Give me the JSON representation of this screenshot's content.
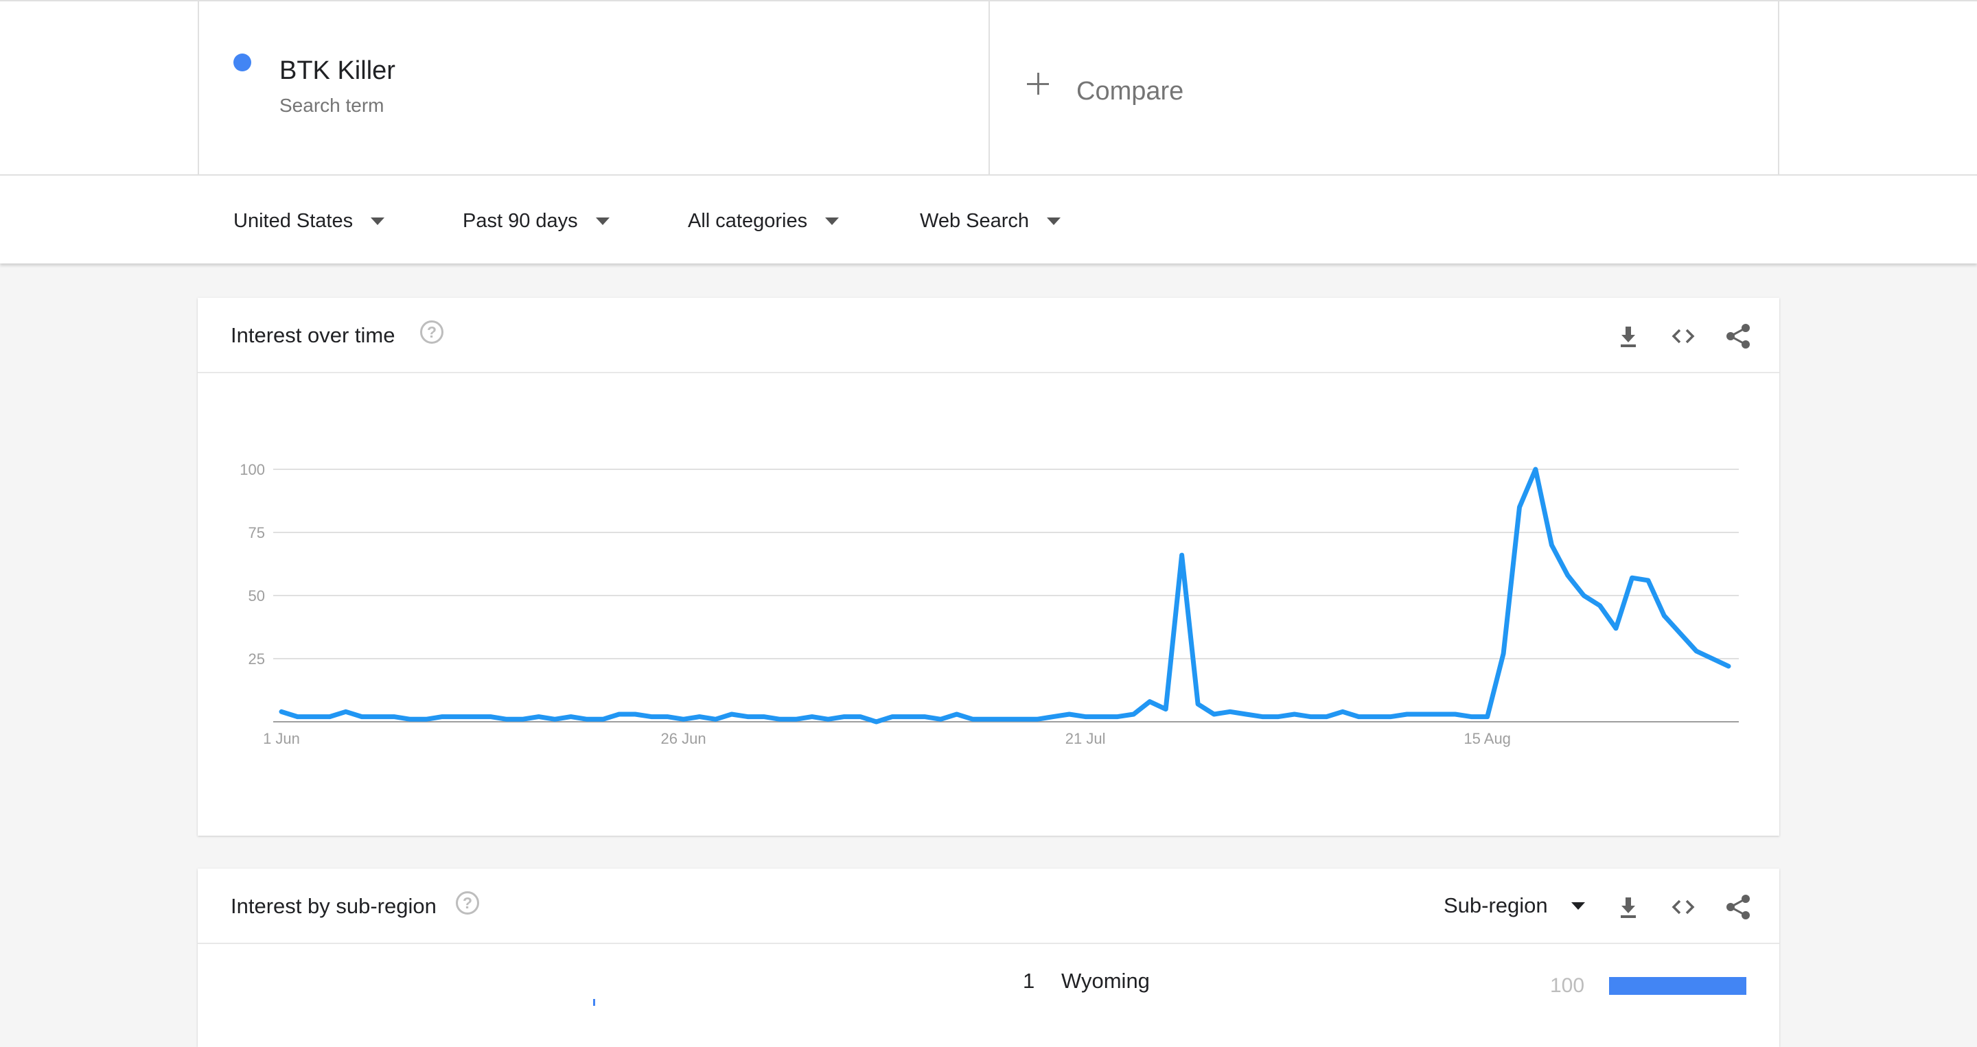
{
  "search_term": {
    "name": "BTK Killer",
    "subtitle": "Search term",
    "color": "#4285f4"
  },
  "compare": {
    "label": "Compare"
  },
  "filters": {
    "region": "United States",
    "time": "Past 90 days",
    "category": "All categories",
    "property": "Web Search"
  },
  "interest_over_time": {
    "title": "Interest over time",
    "help_icon_glyph": "?",
    "actions": [
      "download-icon",
      "embed-code-icon",
      "share-icon"
    ]
  },
  "interest_by_subregion": {
    "title": "Interest by sub-region",
    "help_icon_glyph": "?",
    "resolution_select": "Sub-region",
    "actions": [
      "download-icon",
      "embed-code-icon",
      "share-icon"
    ],
    "rows": [
      {
        "rank": "1",
        "name": "Wyoming",
        "value": "100",
        "bar_fraction": 1.0
      }
    ]
  },
  "chart_data": {
    "type": "line",
    "title": "Interest over time",
    "x_tick_labels": [
      "1 Jun",
      "26 Jun",
      "21 Jul",
      "15 Aug"
    ],
    "y_tick_labels": [
      "100",
      "75",
      "50",
      "25"
    ],
    "ylim": [
      0,
      100
    ],
    "grid": true,
    "line_color": "#2196f3",
    "series": [
      {
        "name": "BTK Killer",
        "values": [
          4,
          2,
          2,
          2,
          4,
          2,
          2,
          2,
          1,
          1,
          2,
          2,
          2,
          2,
          1,
          1,
          2,
          1,
          2,
          1,
          1,
          3,
          3,
          2,
          2,
          1,
          2,
          1,
          3,
          2,
          2,
          1,
          1,
          2,
          1,
          2,
          2,
          0,
          2,
          2,
          2,
          1,
          3,
          1,
          1,
          1,
          1,
          1,
          2,
          3,
          2,
          2,
          2,
          3,
          8,
          5,
          66,
          7,
          3,
          4,
          3,
          2,
          2,
          3,
          2,
          2,
          4,
          2,
          2,
          2,
          3,
          3,
          3,
          3,
          2,
          2,
          27,
          85,
          100,
          70,
          58,
          50,
          46,
          37,
          57,
          56,
          42,
          35,
          28,
          25,
          22
        ]
      }
    ]
  }
}
